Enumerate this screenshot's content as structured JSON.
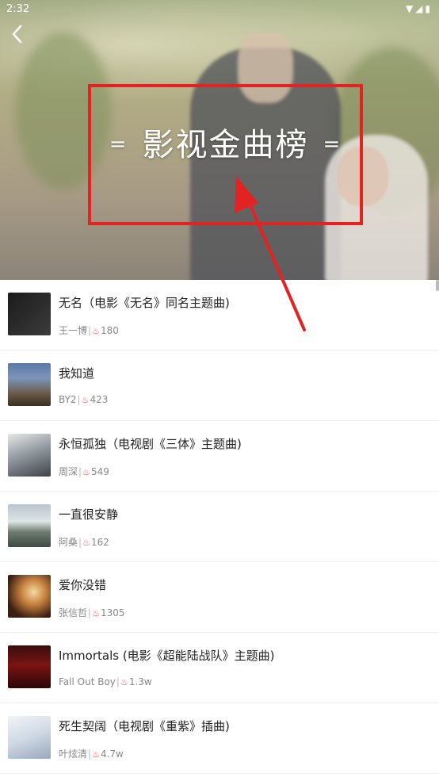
{
  "status": {
    "time": "2:32",
    "icons": "▼◢▮"
  },
  "header": {
    "back_icon": "chevron-left-icon",
    "title": "影视金曲榜",
    "title_deco": "="
  },
  "songs": [
    {
      "title": "无名（电影《无名》同名主题曲)",
      "artist": "王一博",
      "heat": "180",
      "cover": "c1"
    },
    {
      "title": "我知道",
      "artist": "BY2",
      "heat": "423",
      "cover": "c2"
    },
    {
      "title": "永恒孤独（电视剧《三体》主题曲)",
      "artist": "周深",
      "heat": "549",
      "cover": "c3"
    },
    {
      "title": "一直很安静",
      "artist": "阿桑",
      "heat": "162",
      "cover": "c4"
    },
    {
      "title": "爱你没错",
      "artist": "张信哲",
      "heat": "1305",
      "cover": "c5"
    },
    {
      "title": "Immortals (电影《超能陆战队》主题曲)",
      "artist": "Fall Out Boy",
      "heat": "1.3w",
      "cover": "c6"
    },
    {
      "title": "死生契阔（电视剧《重紫》插曲)",
      "artist": "叶炫清",
      "heat": "4.7w",
      "cover": "c7"
    }
  ],
  "colors": {
    "annotation": "#e32222",
    "heat_icon": "#e84c3d"
  }
}
